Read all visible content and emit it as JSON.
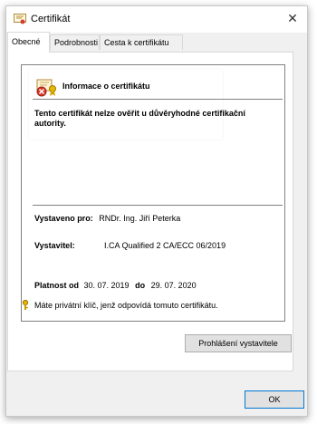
{
  "window": {
    "title": "Certifikát"
  },
  "tabs": [
    "Obecné",
    "Podrobnosti",
    "Cesta k certifikátu"
  ],
  "info": {
    "heading": "Informace o certifikátu",
    "warning": "Tento certifikát nelze ověřit u důvěryhodné certifikační autority."
  },
  "fields": {
    "issued_to_label": "Vystaveno pro:",
    "issued_to_value": "RNDr. Ing. Jiří Peterka",
    "issuer_label": "Vystavitel:",
    "issuer_value": "I.CA Qualified 2 CA/ECC 06/2019",
    "validity_label": "Platnost od",
    "valid_from": "30. 07. 2019",
    "to_label": "do",
    "valid_to": "29. 07. 2020",
    "private_key_note": "Máte privátní klíč, jenž odpovídá tomuto certifikátu."
  },
  "buttons": {
    "issuer_statement": "Prohlášení vystavitele",
    "ok": "OK"
  }
}
